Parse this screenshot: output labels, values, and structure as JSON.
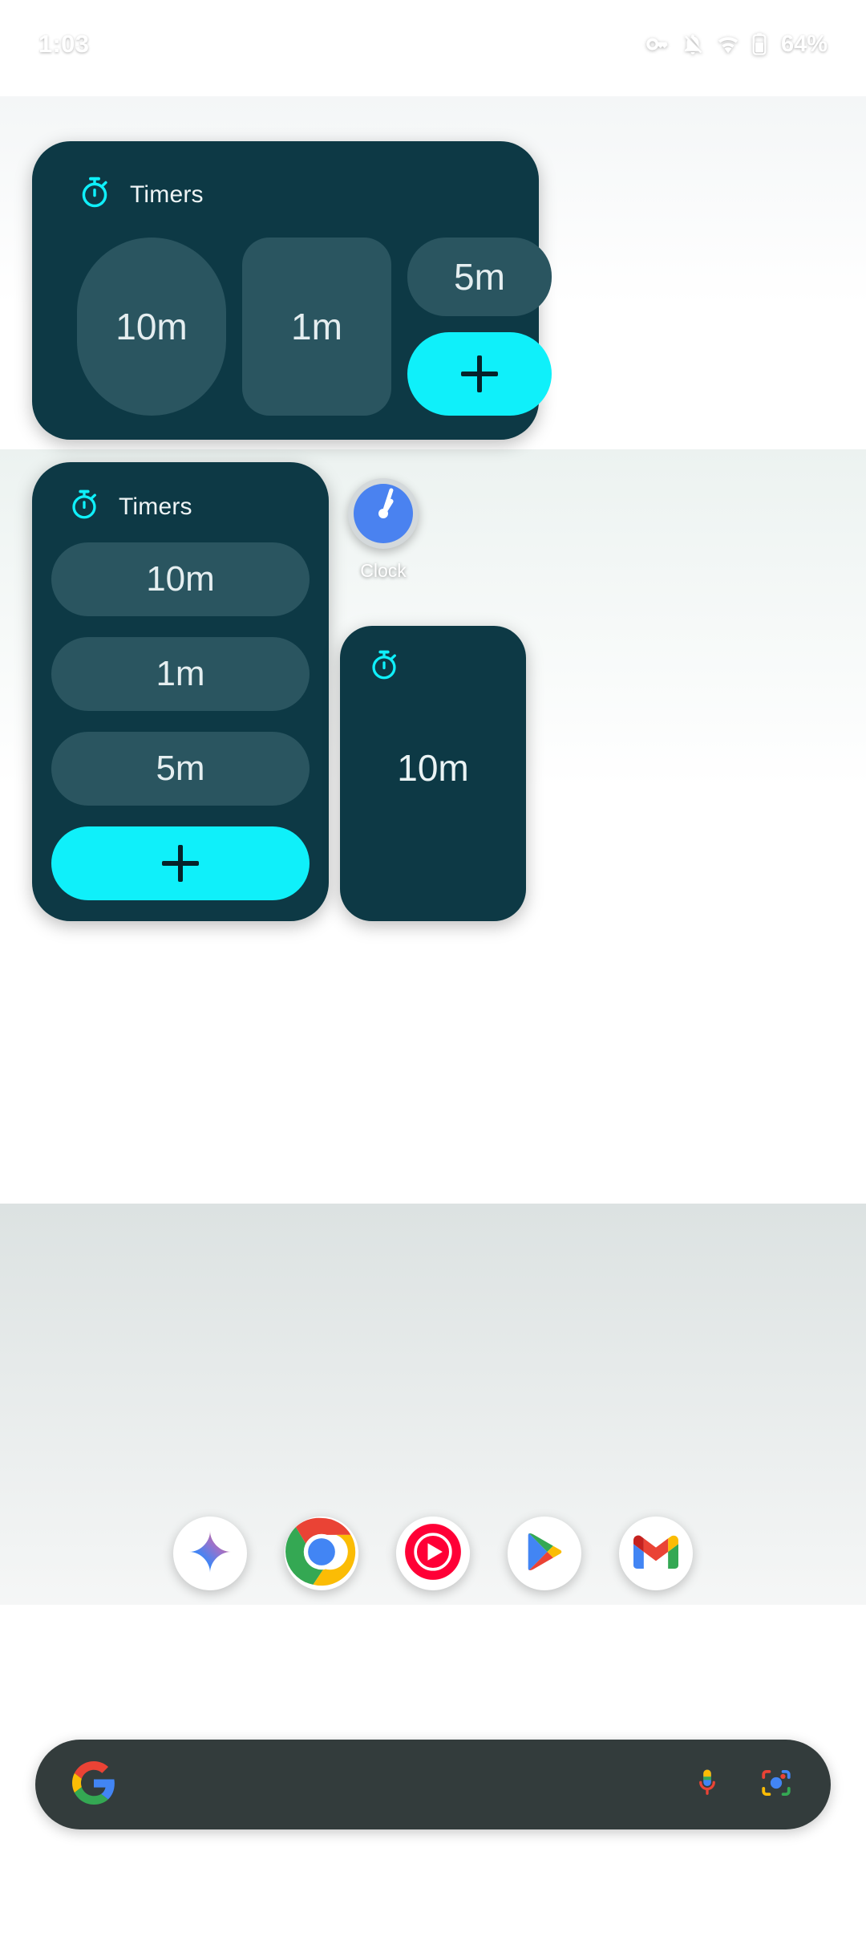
{
  "status_bar": {
    "time": "1:03",
    "battery_percent": "64%",
    "icons": [
      "vpn-key-icon",
      "notifications-muted-icon",
      "wifi-icon",
      "battery-icon"
    ]
  },
  "colors": {
    "widget_background": "#0d3945",
    "timer_pill": "#2a5560",
    "accent_cyan": "#0ff0fa",
    "clock_face_blue": "#4a82f0",
    "clock_ring": "#d4d9db",
    "search_bar": "#333c3c",
    "text_primary": "#eef4f5"
  },
  "widgets": [
    {
      "name": "timers-widget-grid",
      "title": "Timers",
      "icon": "stopwatch-icon",
      "timers": [
        "10m",
        "1m",
        "5m"
      ],
      "add_button_label": "+"
    },
    {
      "name": "timers-widget-list",
      "title": "Timers",
      "icon": "stopwatch-icon",
      "timers": [
        "10m",
        "1m",
        "5m"
      ],
      "add_button_label": "+"
    },
    {
      "name": "timers-widget-compact",
      "icon": "stopwatch-icon",
      "timers": [
        "10m"
      ]
    }
  ],
  "clock_widget": {
    "label": "Clock",
    "icon": "analog-clock-icon"
  },
  "dock": {
    "apps": [
      {
        "name": "gemini",
        "label": "Gemini",
        "icon": "gemini-sparkle-icon"
      },
      {
        "name": "chrome",
        "label": "Chrome",
        "icon": "chrome-icon"
      },
      {
        "name": "youtube-music",
        "label": "YouTube Music",
        "icon": "youtube-music-icon"
      },
      {
        "name": "play-store",
        "label": "Play Store",
        "icon": "play-store-icon"
      },
      {
        "name": "gmail",
        "label": "Gmail",
        "icon": "gmail-icon"
      }
    ]
  },
  "search": {
    "placeholder": "",
    "value": "",
    "google_icon": "google-g-icon",
    "voice_icon": "microphone-icon",
    "lens_icon": "google-lens-icon"
  },
  "navigation": {
    "home_handle": "gesture-nav-handle"
  }
}
